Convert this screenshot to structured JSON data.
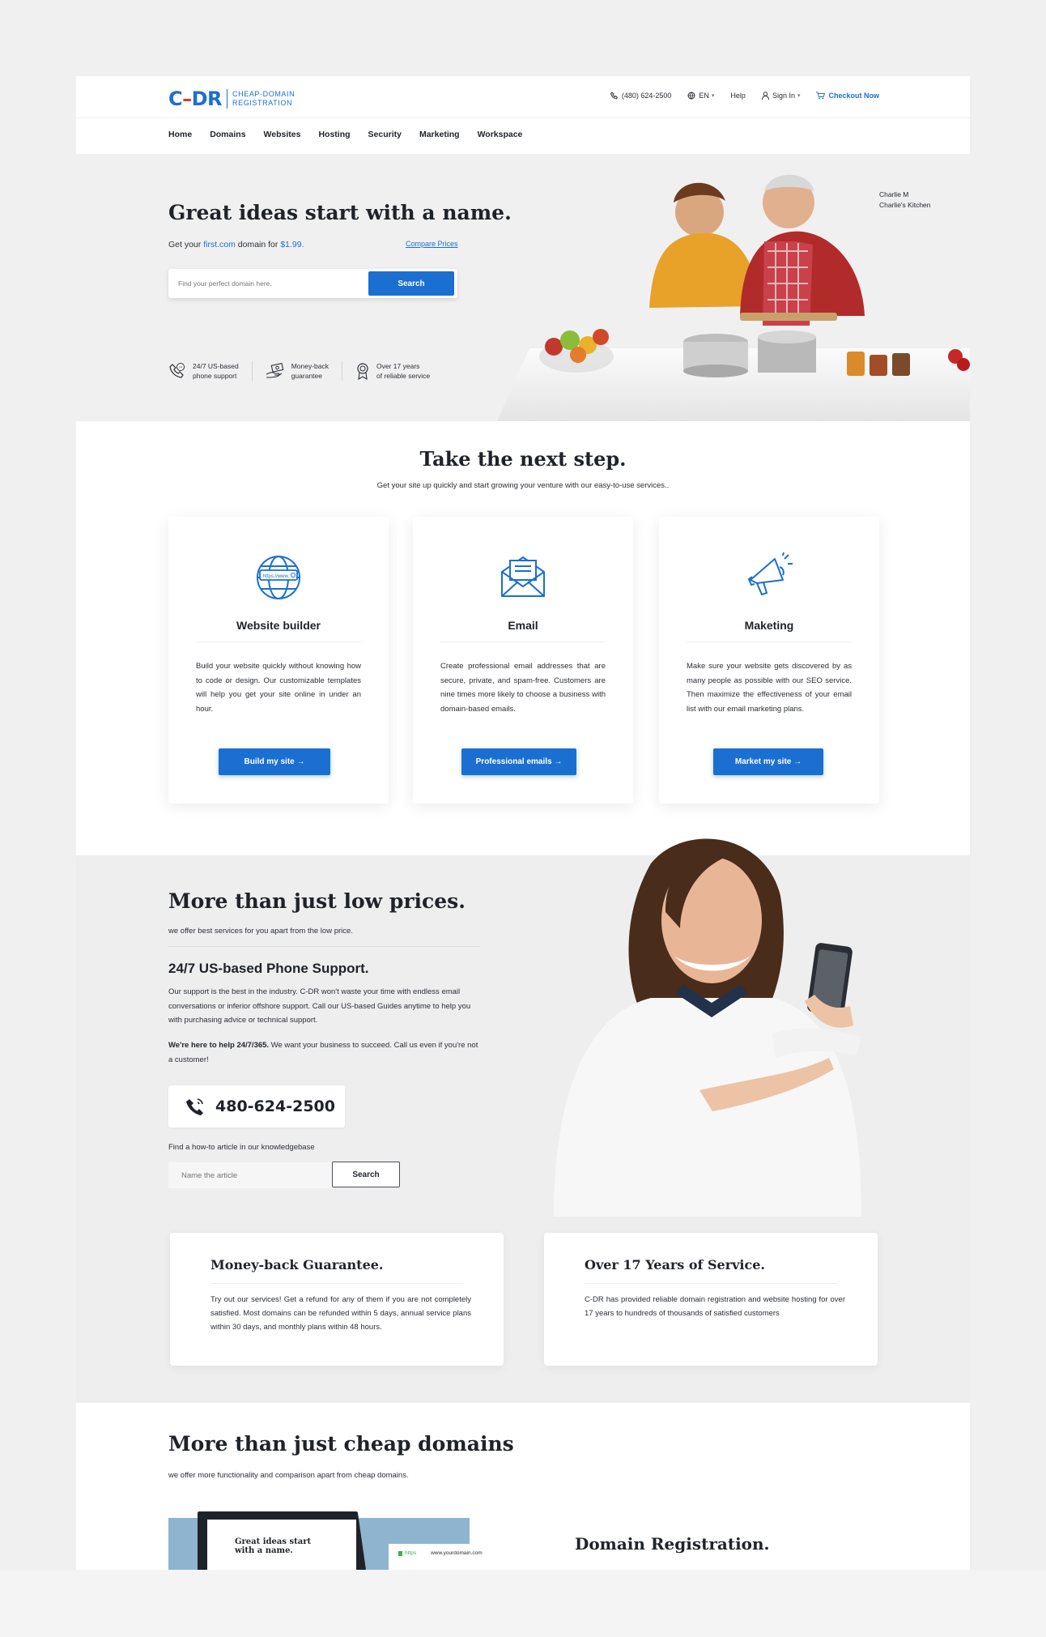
{
  "logo": {
    "mark_left": "C",
    "mark_dash": "–",
    "mark_right": "DR",
    "line1": "CHEAP-DOMAIN",
    "line2": "REGISTRATION"
  },
  "utils": {
    "phone": "(480) 624-2500",
    "lang": "EN",
    "help": "Help",
    "signin": "Sign In",
    "checkout": "Checkout Now"
  },
  "nav": [
    "Home",
    "Domains",
    "Websites",
    "Hosting",
    "Security",
    "Marketing",
    "Workspace"
  ],
  "hero": {
    "title": "Great ideas start with a name.",
    "sub_pre": "Get your ",
    "sub_domain": "first.com",
    "sub_mid": " domain for ",
    "sub_price": "$1.99.",
    "compare": "Compare Prices",
    "search_placeholder": "Find your perfect domain here.",
    "search_button": "Search",
    "caption_name": "Charlie M",
    "caption_company": "Charlie's Kitchen",
    "features": [
      {
        "line1": "24/7 US-based",
        "line2": "phone support"
      },
      {
        "line1": "Money-back",
        "line2": "guarantee"
      },
      {
        "line1": "Over 17 years",
        "line2": "of reliable service"
      }
    ]
  },
  "next_step": {
    "title": "Take the next step.",
    "subtitle": "Get your site up quickly and start growing your venture with our easy-to-use services..",
    "cards": [
      {
        "icon": "globe-icon",
        "title": "Website builder",
        "desc": "Build your website quickly without knowing how to code or design.  Our customizable templates will help you get your site online in under an hour.",
        "button": "Build my site →"
      },
      {
        "icon": "envelope-icon",
        "title": "Email",
        "desc": "Create professional email addresses that are secure, private, and spam-free. Customers are nine times more likely to choose a business with domain-based emails.",
        "button": "Professional emails →"
      },
      {
        "icon": "megaphone-icon",
        "title": "Maketing",
        "desc": "Make sure your website gets discovered by as many people as possible with our SEO service.   Then maximize the effectiveness of your email list with our email marketing plans.",
        "button": "Market my site →"
      }
    ]
  },
  "prices": {
    "title": "More than just low prices.",
    "subtitle": "we offer best services for you apart from the low price.",
    "support_title": "24/7 US-based Phone Support.",
    "support_p1": "Our support is the best in the industry.  C-DR won't waste your time with endless email conversations or inferior offshore support.  Call our US-based Guides anytime to help you with purchasing advice or technical support.",
    "support_p2_bold": "We're here to help 24/7/365.",
    "support_p2": "  We want your business to succeed. Call us even if you're not a customer!",
    "phone": "480-624-2500",
    "kb_label": "Find a how-to article in our knowledgebase",
    "kb_placeholder": "Name the article",
    "kb_button": "Search",
    "info": [
      {
        "title": "Money-back Guarantee.",
        "text": "Try out our services!  Get a refund for any of them if you are not completely satisfied.  Most domains can be refunded within 5 days, annual service plans within 30 days, and monthly plans within 48 hours."
      },
      {
        "title": "Over 17 Years of Service.",
        "text": "C-DR has provided reliable domain registration and website hosting for over 17 years to hundreds of thousands of satisfied customers"
      }
    ]
  },
  "domains": {
    "title": "More than just cheap domains",
    "subtitle": "we offer more functionality and comparison  apart from cheap domains.",
    "laptop_text1": "Great ideas start",
    "laptop_text2": "with a name.",
    "url_https": "https",
    "url_domain": "www.yourdomain.com",
    "registration_title": "Domain Registration."
  },
  "colors": {
    "accent": "#1b6fd0",
    "logo_dash": "#e0392b",
    "section_bg": "#eeeeef"
  }
}
